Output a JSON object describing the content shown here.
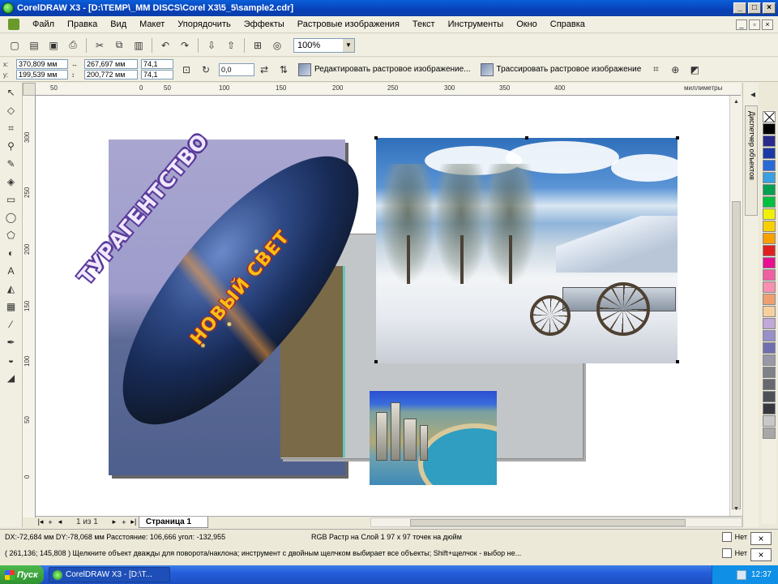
{
  "window": {
    "title": "CorelDRAW X3 - [D:\\TEMP\\_MM DISCS\\Corel X3\\5_5\\sample2.cdr]",
    "controls": [
      "_",
      "□",
      "×"
    ]
  },
  "menu": {
    "items": [
      "Файл",
      "Правка",
      "Вид",
      "Макет",
      "Упорядочить",
      "Эффекты",
      "Растровые изображения",
      "Текст",
      "Инструменты",
      "Окно",
      "Справка"
    ]
  },
  "toolbar": {
    "zoom_value": "100%"
  },
  "property_bar": {
    "x_label": "x:",
    "x_value": "370,809 мм",
    "y_label": "y:",
    "y_value": "199,539 мм",
    "w_value": "267,697 мм",
    "h_value": "200,772 мм",
    "scale_w": "74,1",
    "scale_h": "74,1",
    "rotation": "0,0",
    "edit_bitmap_label": "Редактировать растровое изображение...",
    "trace_bitmap_label": "Трассировать растровое изображение"
  },
  "ruler": {
    "units": "миллиметры",
    "h_ticks": [
      "50",
      "0",
      "50",
      "100",
      "150",
      "200",
      "250",
      "300",
      "350",
      "400"
    ],
    "v_ticks": [
      "300",
      "250",
      "200",
      "150",
      "100",
      "50",
      "0"
    ]
  },
  "artwork": {
    "headline_1": "ТУРАГЕНТСТВО",
    "headline_2": "НОВЫЙ СВЕТ"
  },
  "docker": {
    "tab_label": "Диспетчер объектов"
  },
  "palette": {
    "colors": [
      "#000000",
      "#2a2a8a",
      "#1a3aa8",
      "#2a6ad8",
      "#3aa0e0",
      "#00a050",
      "#00c040",
      "#f0f000",
      "#f8d000",
      "#f8a000",
      "#e02020",
      "#e81090",
      "#f060a0",
      "#f890b0",
      "#f0a070",
      "#f8d0a0",
      "#c0a8d8",
      "#9890c8",
      "#7070b0",
      "#9898a8",
      "#808088",
      "#686870",
      "#505058",
      "#383840",
      "#c8c8c8",
      "#a8a8a8"
    ]
  },
  "pages": {
    "count_text": "1 из 1",
    "tab_label": "Страница 1"
  },
  "status": {
    "line1": "DX:-72,684 мм DY:-78,068 мм Расстояние: 106,666 угол: -132,955",
    "line1_right": "RGB Растр на Слой 1 97 x 97 точек на дюйм",
    "line2": "( 261,136; 145,808 )   Щелкните объект дважды для поворота/наклона; инструмент с двойным щелчком выбирает все объекты; Shift+щелчок - выбор не...",
    "fill_label": "Нет",
    "outline_label": "Нет"
  },
  "taskbar": {
    "start_label": "Пуск",
    "task_label": "CorelDRAW X3 - [D:\\T...",
    "clock": "12:37"
  }
}
